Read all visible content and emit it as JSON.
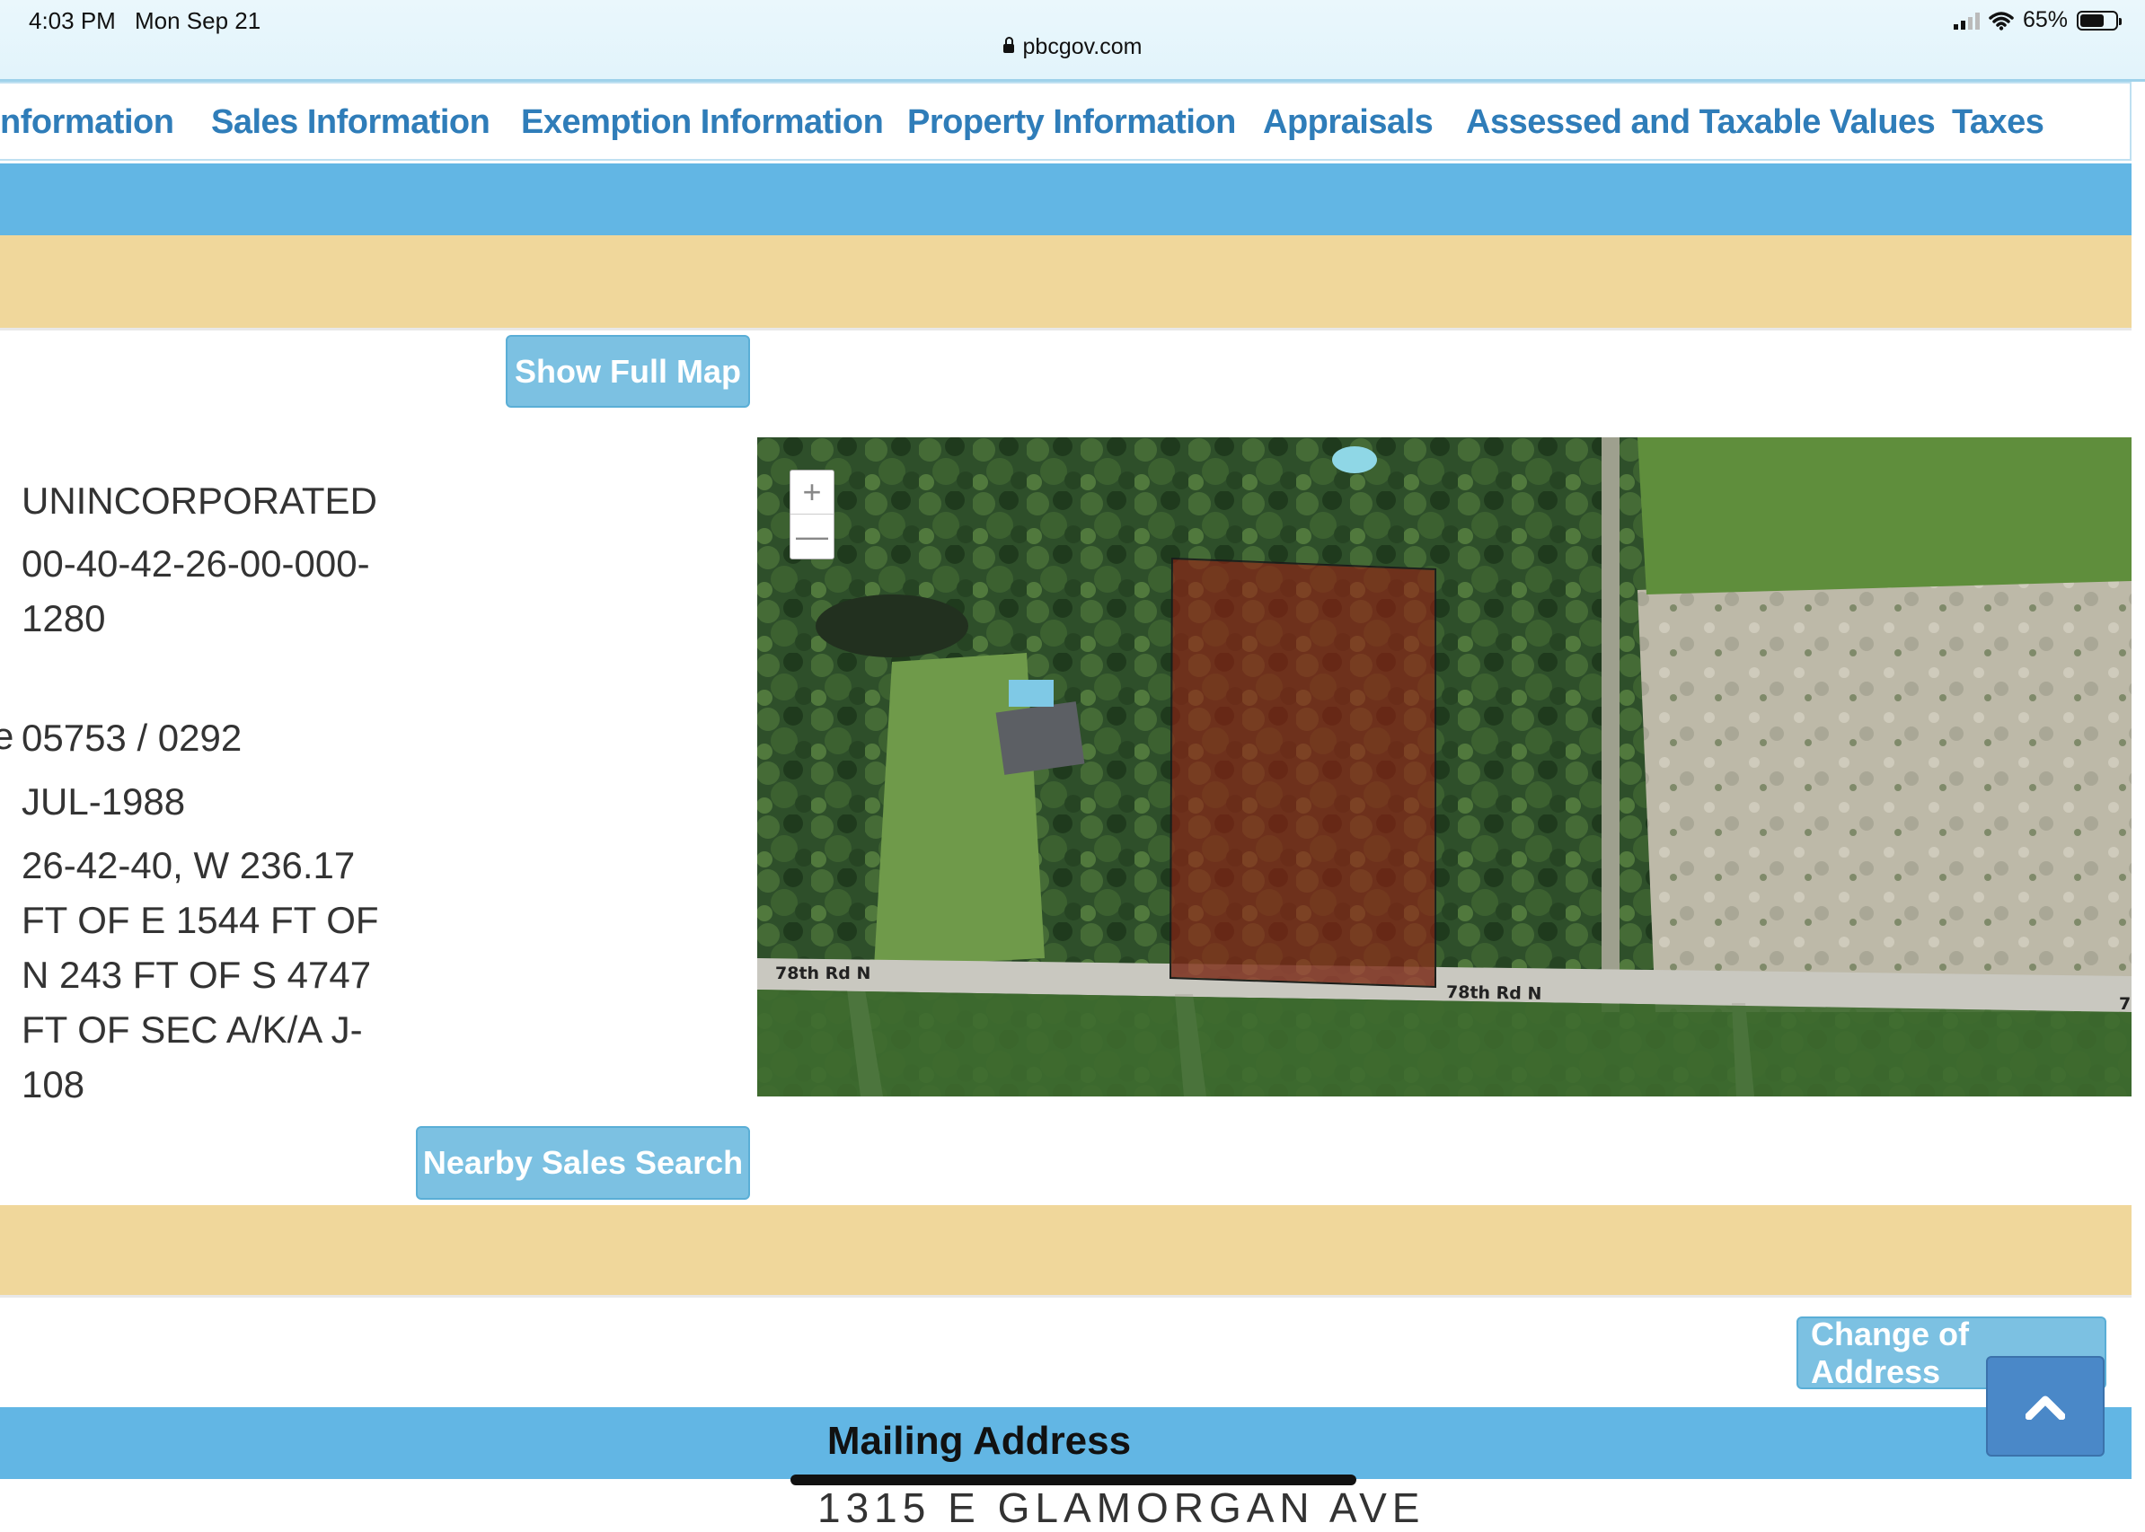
{
  "status_bar": {
    "time": "4:03 PM",
    "date": "Mon Sep 21",
    "url": "pbcgov.com",
    "battery": "65%"
  },
  "nav": {
    "tabs": [
      "nformation",
      "Sales Information",
      "Exemption Information",
      "Property Information",
      "Appraisals",
      "Assessed and Taxable Values",
      "Taxes"
    ]
  },
  "buttons": {
    "show_full_map": "Show Full Map",
    "nearby_sales_search": "Nearby Sales Search",
    "change_of_address": "Change of Address"
  },
  "property": {
    "municipality": "UNINCORPORATED",
    "parcel_line1": "00-40-42-26-00-000-",
    "parcel_line2": "1280",
    "edge_char": "e",
    "book_page": "05753 / 0292",
    "sale_date": "JUL-1988",
    "legal_lines": [
      "26-42-40, W 236.17",
      "FT OF E 1544 FT OF",
      "N 243 FT OF S 4747",
      "FT OF SEC A/K/A J-",
      "108"
    ]
  },
  "map": {
    "zoom_in": "+",
    "zoom_out": "—",
    "road_labels": [
      "78th Rd N",
      "78th Rd N",
      "7"
    ],
    "highlight_color": "#9b1c12"
  },
  "mailing": {
    "title": "Mailing Address",
    "cut_off_text": "1315 E GLAMORGAN AVE"
  },
  "colors": {
    "nav_link": "#2f7db9",
    "blue_band": "#62b6e4",
    "tan_band": "#f0d79b",
    "button": "#7cc1e2",
    "scroll_top": "#4a88c8"
  },
  "icons": {
    "scroll_top": "chevron-up-icon",
    "lock": "lock-icon",
    "wifi": "wifi-icon",
    "signal": "signal-icon",
    "battery": "battery-icon"
  }
}
